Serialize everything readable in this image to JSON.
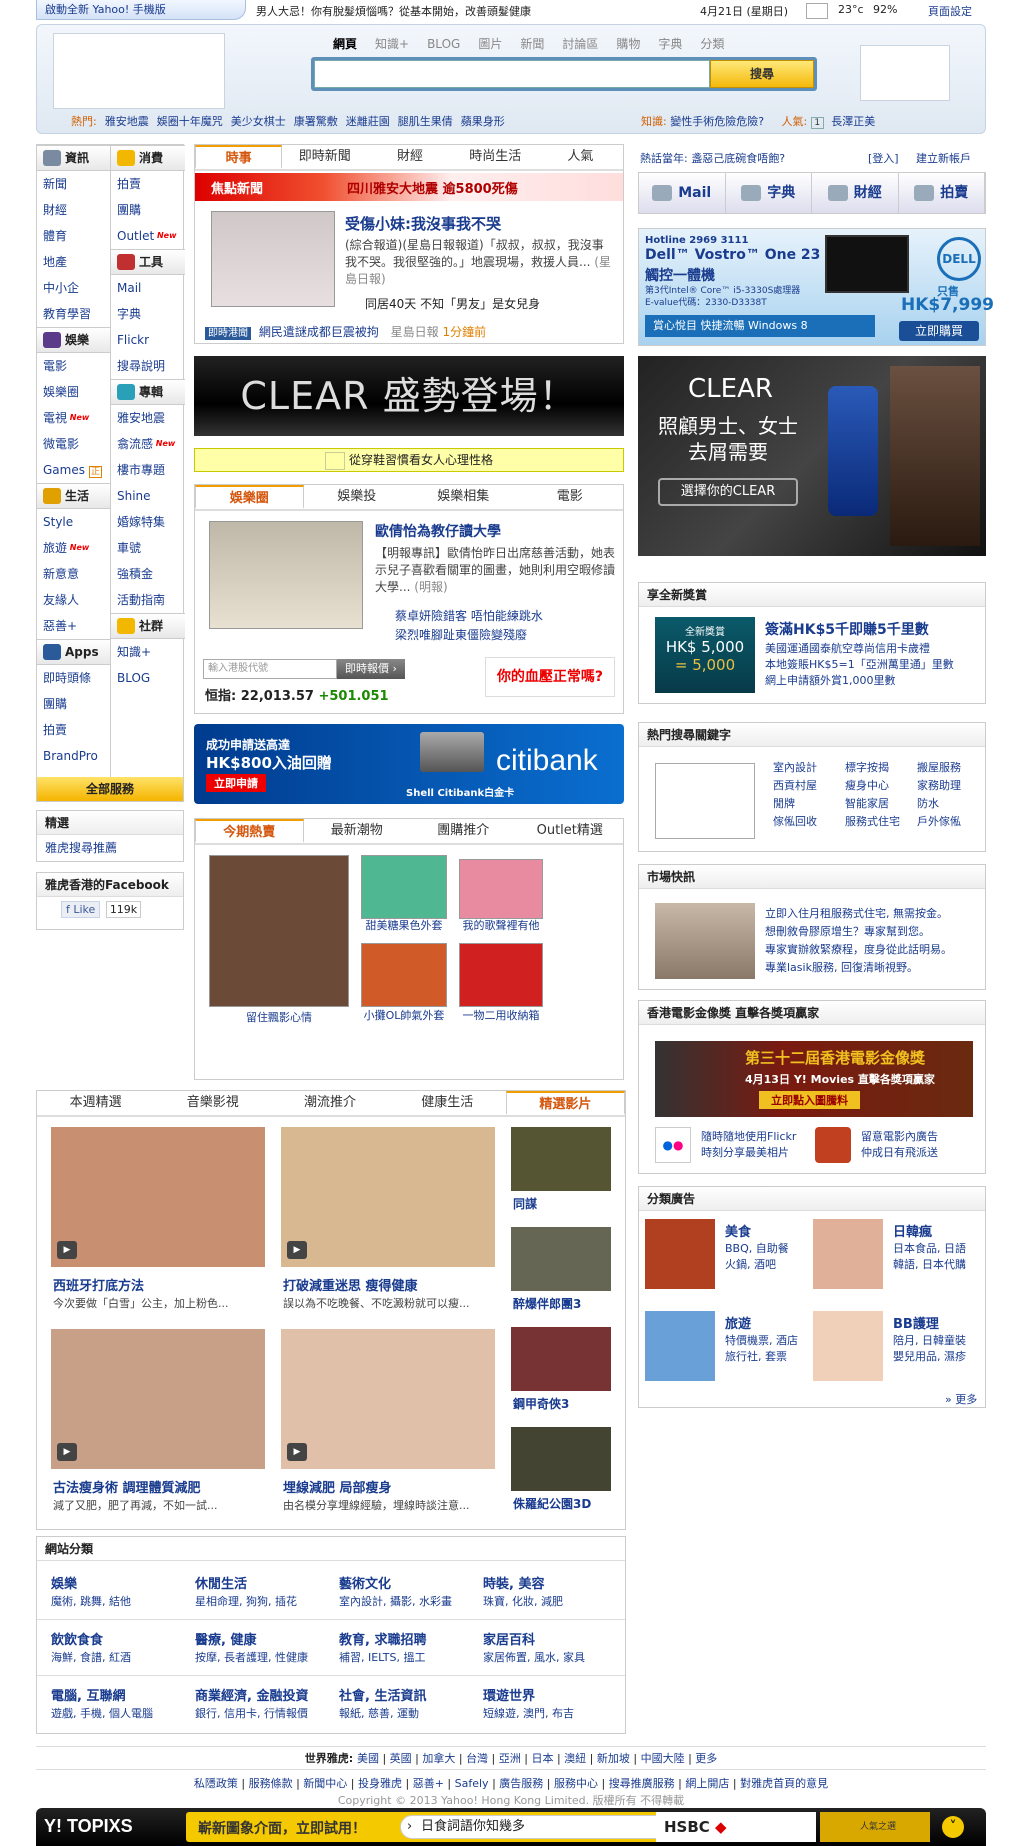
{
  "topbar": {
    "promo_tab": "啟動全新 Yahoo! 手機版",
    "promo_link": "男人大忌！你有脫髮煩惱嗎？從基本開始，改善頭髮健康",
    "date": "4月21日 (星期日)",
    "temp": "23°c",
    "humidity": "92%",
    "page_setting": "頁面設定"
  },
  "search": {
    "tabs": [
      "網頁",
      "知識+",
      "BLOG",
      "圖片",
      "新聞",
      "討論區",
      "購物",
      "字典",
      "分類"
    ],
    "button": "搜尋",
    "hot_label": "熱門:",
    "hot_items": [
      "雅安地震",
      "娛圈十年魔咒",
      "美少女棋士",
      "康署驚敷",
      "迷離莊園",
      "腿肌生果倩",
      "蘋果身形"
    ],
    "know_label": "知識:",
    "know_item": "變性手術危險危險?",
    "pop_label": "人氣:",
    "pop_num": "1",
    "pop_item": "長澤正美"
  },
  "leftnav": {
    "col1": [
      {
        "type": "head",
        "label": "資訊",
        "icon": "newspaper-icon",
        "color": "#7a8aa0"
      },
      {
        "type": "item",
        "label": "新聞"
      },
      {
        "type": "item",
        "label": "財經"
      },
      {
        "type": "item",
        "label": "體育"
      },
      {
        "type": "item",
        "label": "地產"
      },
      {
        "type": "item",
        "label": "中小企"
      },
      {
        "type": "item",
        "label": "教育學習"
      },
      {
        "type": "head",
        "label": "娛樂",
        "icon": "film-icon",
        "color": "#5b3a8a"
      },
      {
        "type": "item",
        "label": "電影"
      },
      {
        "type": "item",
        "label": "娛樂圈"
      },
      {
        "type": "item",
        "label": "電視",
        "new": "New"
      },
      {
        "type": "item",
        "label": "微電影"
      },
      {
        "type": "item",
        "label": "Games",
        "badge": "正"
      },
      {
        "type": "head",
        "label": "生活",
        "icon": "lock-icon",
        "color": "#e0a000"
      },
      {
        "type": "item",
        "label": "Style"
      },
      {
        "type": "item",
        "label": "旅遊",
        "new": "New"
      },
      {
        "type": "item",
        "label": "新意意"
      },
      {
        "type": "item",
        "label": "友緣人"
      },
      {
        "type": "item",
        "label": "惡善+"
      },
      {
        "type": "head",
        "label": "Apps",
        "icon": "apps-icon",
        "color": "#2a5a9a"
      },
      {
        "type": "item",
        "label": "即時頭條"
      },
      {
        "type": "item",
        "label": "團購"
      },
      {
        "type": "item",
        "label": "拍賣"
      },
      {
        "type": "item",
        "label": "BrandPro"
      }
    ],
    "col2": [
      {
        "type": "head",
        "label": "消費",
        "icon": "shopping-bag-icon",
        "color": "#f2b800"
      },
      {
        "type": "item",
        "label": "拍賣"
      },
      {
        "type": "item",
        "label": "團購"
      },
      {
        "type": "item",
        "label": "Outlet",
        "new": "New"
      },
      {
        "type": "head",
        "label": "工具",
        "icon": "wrench-icon",
        "color": "#c03030"
      },
      {
        "type": "item",
        "label": "Mail"
      },
      {
        "type": "item",
        "label": "字典"
      },
      {
        "type": "item",
        "label": "Flickr"
      },
      {
        "type": "item",
        "label": "搜尋說明"
      },
      {
        "type": "head",
        "label": "專輯",
        "icon": "star-icon",
        "color": "#2aa0b8"
      },
      {
        "type": "item",
        "label": "雅安地震"
      },
      {
        "type": "item",
        "label": "翕流感",
        "new": "New"
      },
      {
        "type": "item",
        "label": "樓市專題"
      },
      {
        "type": "item",
        "label": "Shine"
      },
      {
        "type": "item",
        "label": "婚嫁特集"
      },
      {
        "type": "item",
        "label": "車號"
      },
      {
        "type": "item",
        "label": "強積金"
      },
      {
        "type": "item",
        "label": "活動指南"
      },
      {
        "type": "head",
        "label": "社群",
        "icon": "smiley-icon",
        "color": "#f2b800"
      },
      {
        "type": "item",
        "label": "知識+"
      },
      {
        "type": "item",
        "label": "BLOG"
      }
    ],
    "all_services": "全部服務"
  },
  "picks": {
    "title": "精選",
    "item": "雅虎搜尋推薦"
  },
  "facebook": {
    "title": "雅虎香港的Facebook",
    "like": "Like",
    "count": "119k"
  },
  "news": {
    "tabs": [
      "時事",
      "即時新聞",
      "財經",
      "時尚生活",
      "人氣"
    ],
    "focus_label": "焦點新聞",
    "focus_headline": "四川雅安大地震 逾5800死傷",
    "title": "受傷小妹:我沒事我不哭",
    "summary": "(綜合報道)(星島日報報道)「叔叔，叔叔，我沒事我不哭。我很堅強的。」地震現場，救援人員...",
    "source": "(星島日報)",
    "related": "同居40天 不知「男友」是女兒身",
    "instant_badge": "即時港聞",
    "instant_text": "網民遣謎成都巨震被拘",
    "instant_src": "星島日報",
    "instant_time": "1分鐘前"
  },
  "clear_banner": "CLEAR 盛勢登場！",
  "yellow_bar": "從穿鞋習慣看女人心理性格",
  "ent": {
    "tabs": [
      "娛樂圈",
      "娛樂投",
      "娛樂相集",
      "電影"
    ],
    "title": "歐倩怡為教仔讀大學",
    "summary": "【明報專訊】歐倩怡昨日出席慈善活動，她表示兒子喜歡看關軍的圖畫，她則利用空暇修讀大學...",
    "source": "(明報)",
    "related1": "蔡卓妍險錯客 唔怕能練跳水",
    "related2": "梁烈唯腳趾東僵險變殘廢",
    "stock_placeholder": "輸入港股代號",
    "stock_btn": "即時報價",
    "hsi_label": "恒指:",
    "hsi_value": "22,013.57",
    "hsi_change": "+501.051",
    "blood_ad": "你的血壓正常嗎?"
  },
  "citi": {
    "l1": "成功申請送高達",
    "l2": "HK$800入油回贈",
    "btn": "立即申請",
    "sub": "Shell Citibank白金卡",
    "brand": "citibank"
  },
  "hot": {
    "tabs": [
      "今期熱賣",
      "最新潮物",
      "團購推介",
      "Outlet精選"
    ],
    "items": [
      {
        "caption": "留住飄影心情",
        "color": "#6b4a38"
      },
      {
        "caption": "甜美糖果色外套",
        "color": "#4fb892"
      },
      {
        "caption": "我的歌聲裡有他",
        "color": "#e88aa0"
      },
      {
        "caption": "小攤OL帥氣外套",
        "color": "#d05a28"
      },
      {
        "caption": "一物二用收納箱",
        "color": "#d02020"
      }
    ]
  },
  "video": {
    "tabs": [
      "本週精選",
      "音樂影視",
      "潮流推介",
      "健康生活",
      "精選影片"
    ],
    "main": [
      {
        "title": "西班牙打底方法",
        "sub": "今次要做「白雪」公主，加上粉色...",
        "color": "#c89070"
      },
      {
        "title": "打破減重迷思 瘦得健康",
        "sub": "誤以為不吃晚餐、不吃澱粉就可以瘦...",
        "color": "#d8b890"
      },
      {
        "title": "古法瘦身術 調理體質減肥",
        "sub": "減了又肥，肥了再減，不如一試...",
        "color": "#c8a088"
      },
      {
        "title": "埋線減肥 局部瘦身",
        "sub": "由名模分享埋線經驗，埋線時談注意...",
        "color": "#e0c0a8"
      }
    ],
    "side": [
      {
        "title": "同謀",
        "color": "#553"
      },
      {
        "title": "醉爆伴郎團3",
        "color": "#665"
      },
      {
        "title": "鋼甲奇俠3",
        "color": "#733"
      },
      {
        "title": "侏羅紀公園3D",
        "color": "#443"
      }
    ]
  },
  "categories": {
    "title": "網站分類",
    "rows": [
      [
        {
          "h": "娛樂",
          "s": "魔術, 跳舞, 結他"
        },
        {
          "h": "休閒生活",
          "s": "星相命理, 狗狗, 插花"
        },
        {
          "h": "藝術文化",
          "s": "室內設計, 攝影, 水彩畫"
        },
        {
          "h": "時裝, 美容",
          "s": "珠寶, 化妝, 減肥"
        }
      ],
      [
        {
          "h": "飲飲食食",
          "s": "海鮮, 食譜, 紅酒"
        },
        {
          "h": "醫療, 健康",
          "s": "按摩, 長者護理, 性健康"
        },
        {
          "h": "教育, 求職招聘",
          "s": "補習, IELTS, 搵工"
        },
        {
          "h": "家居百科",
          "s": "家居佈置, 風水, 家具"
        }
      ],
      [
        {
          "h": "電腦, 互聯網",
          "s": "遊戲, 手機, 個人電腦"
        },
        {
          "h": "商業經濟, 金融投資",
          "s": "銀行, 信用卡, 行情報價"
        },
        {
          "h": "社會, 生活資訊",
          "s": "報紙, 慈善, 運動"
        },
        {
          "h": "環遊世界",
          "s": "短線遊, 澳門, 布吉"
        }
      ]
    ]
  },
  "footer": {
    "world_label": "世界雅虎:",
    "world": [
      "美國",
      "英國",
      "加拿大",
      "台灣",
      "亞洲",
      "日本",
      "澳紐",
      "新加坡",
      "中國大陸",
      "更多"
    ],
    "links": [
      "私隱政策",
      "服務條款",
      "新聞中心",
      "投身雅虎",
      "惡善+",
      "Safely",
      "廣告服務",
      "服務中心",
      "搜尋推廣服務",
      "網上開店",
      "對雅虎首頁的意見"
    ],
    "copyright": "Copyright © 2013 Yahoo! Hong Kong Limited. 版權所有 不得轉載"
  },
  "toolbar": {
    "topix": "Y! TOPIXS",
    "promo": "嶄新圖象介面，立即試用！",
    "search_value": "日食詞語你知幾多",
    "hsbc": "HSBC",
    "right": "人氣之選"
  },
  "right": {
    "hot_when": "熱話當年: 盞惡己底碗食唔飽?",
    "login": "[登入]",
    "register": "建立新帳戶",
    "services": [
      "Mail",
      "字典",
      "財經",
      "拍賣"
    ],
    "dell": {
      "hotline": "Hotline 2969 3111",
      "model": "Dell™ Vostro™ One 23",
      "model2": "觸控一體機",
      "cpu": "第3代Intel® Core™ i5-3330S處理器",
      "code": "E-value代碼：2330-D3338T",
      "price_lbl": "只售",
      "price": "HK$7,999",
      "btn": "立即購買",
      "win": "賞心悅目 快捷流暢 Windows 8",
      "brand": "DELL"
    },
    "clear_side": {
      "brand": "CLEAR",
      "l1": "照顧男士、女士",
      "l2": "去屑需要",
      "btn": "選擇你的CLEAR"
    },
    "reward": {
      "title": "享全新獎賞",
      "img_l1": "全新獎賞",
      "img_l2": "HK$ 5,000",
      "img_l3": "= 5,000",
      "head": "簽滿HK$5千即賺5千里數",
      "d1": "美國運通國泰航空尊尚信用卡歲禮",
      "d2": "本地簽賬HK$5=1「亞洲萬里通」里數",
      "d3": "網上申請額外賞1,000里數"
    },
    "keywords": {
      "title": "熱門搜尋關鍵字",
      "items": [
        "室內設計",
        "標字按揭",
        "搬屋服務",
        "西貢村屋",
        "瘦身中心",
        "家務助理",
        "閒牌",
        "智能家居",
        "防水",
        "傢俬回收",
        "服務式住宅",
        "戶外傢俬"
      ]
    },
    "market": {
      "title": "市場快訊",
      "items": [
        "立即入住月租服務式住宅, 無需按金。",
        "想刪敘骨膠原增生？專家幫到您。",
        "專家實辦敘緊療程，度身從此話明易。",
        "專業lasik服務, 回復清晰視野。"
      ]
    },
    "film": {
      "title": "香港電影金像獎 直擊各獎項贏家",
      "banner": "第三十二屆香港電影金像獎",
      "date": "4月13日",
      "sub": "Y! Movies 直擊各獎項贏家",
      "btn": "立即點入圖騰料",
      "flickr1": "隨時隨地使用Flickr",
      "flickr2": "時刻分享最美相片",
      "movie1": "留意電影內廣告",
      "movie2": "仲成日有飛派送"
    },
    "classified": {
      "title": "分類廣告",
      "items": [
        {
          "h": "美食",
          "s": "BBQ, 自助餐\n火鍋, 酒吧",
          "color": "#b04020"
        },
        {
          "h": "日韓瘋",
          "s": "日本食品, 日語\n韓語, 日本代購",
          "color": "#e0b098"
        },
        {
          "h": "旅遊",
          "s": "特價機票, 酒店\n旅行社, 套票",
          "color": "#6aa0d8"
        },
        {
          "h": "BB護理",
          "s": "陪月, 日韓童裝\n嬰兒用品, 濕疹",
          "color": "#f0d0b8"
        }
      ],
      "more": "» 更多"
    }
  }
}
